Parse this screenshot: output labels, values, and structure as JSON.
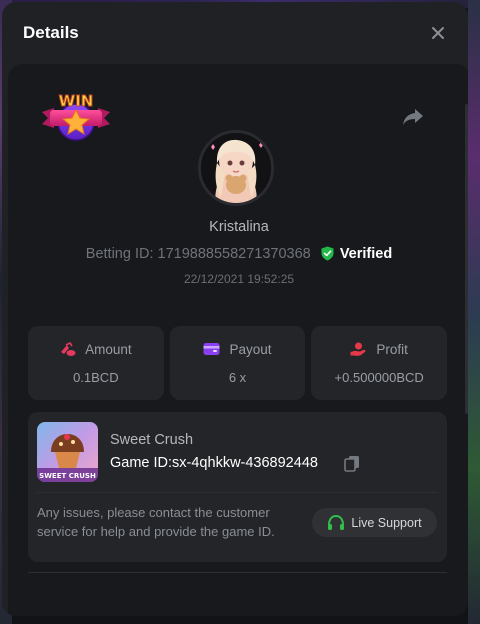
{
  "modal": {
    "title": "Details"
  },
  "bet": {
    "username": "Kristalina",
    "betting_id_label": "Betting ID: 1719888558271370368",
    "verified_label": "Verified",
    "datetime": "22/12/2021 19:52:25",
    "badge_text": "WIN"
  },
  "stats": [
    {
      "label": "Amount",
      "value": "0.1BCD",
      "icon": "coins-icon",
      "color": "#e5395f"
    },
    {
      "label": "Payout",
      "value": "6 x",
      "icon": "wallet-icon",
      "color": "#8a3ff0"
    },
    {
      "label": "Profit",
      "value": "+0.500000BCD",
      "icon": "hand-coin-icon",
      "color": "#e63947"
    }
  ],
  "game": {
    "name": "Sweet Crush",
    "game_id": "Game ID:sx-4qhkkw-436892448",
    "thumb_text": "SWEET CRUSH",
    "issue_text": "Any issues, please contact the customer service for help and provide the game ID.",
    "support_label": "Live Support"
  },
  "colors": {
    "accent_green": "#2fbf4a",
    "verified_green": "#22b84a",
    "modal_bg": "#1f2125",
    "card_bg": "#232529"
  }
}
